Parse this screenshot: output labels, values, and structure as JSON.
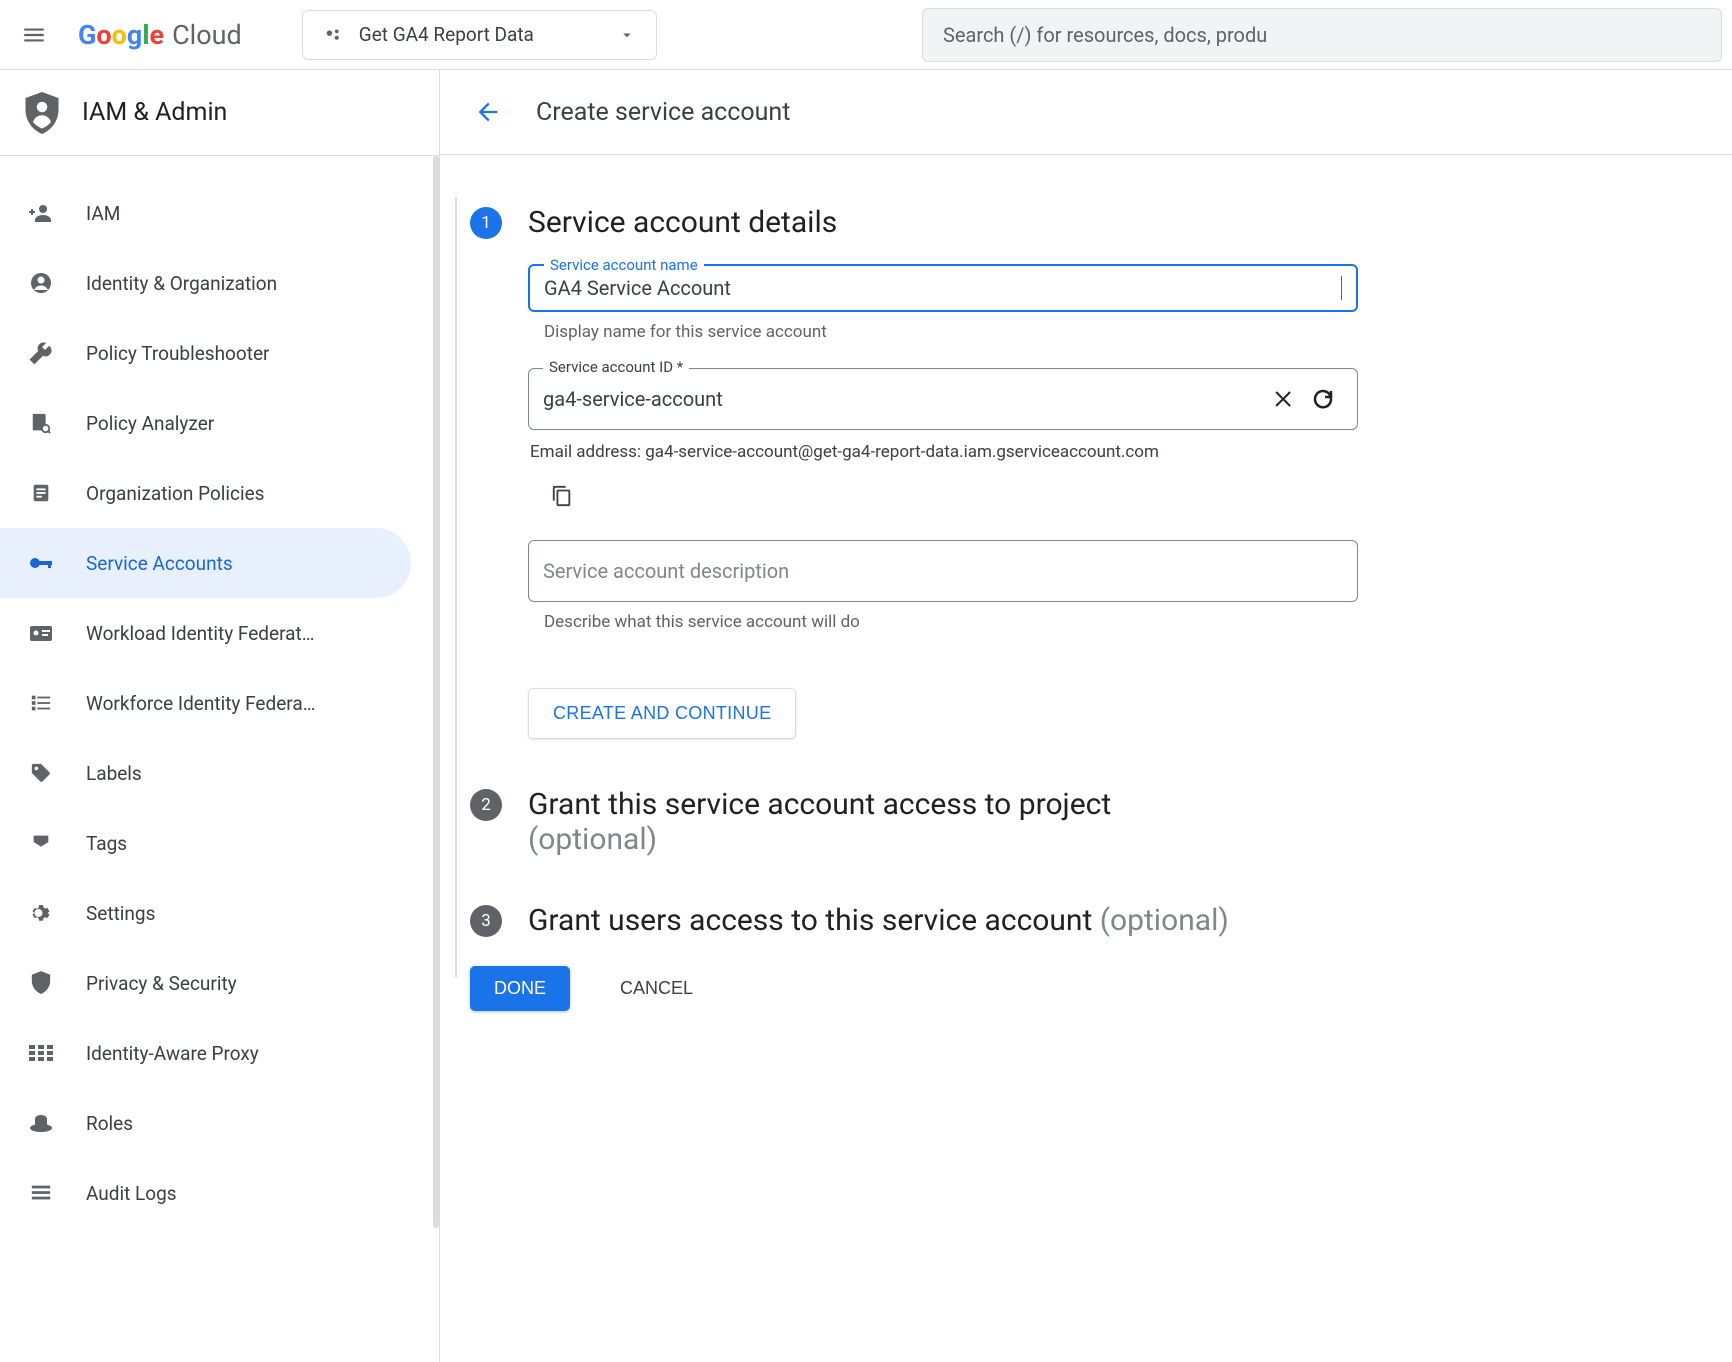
{
  "header": {
    "logo_cloud": "Cloud",
    "project_name": "Get GA4 Report Data",
    "search_placeholder": "Search (/) for resources, docs, produ"
  },
  "sidebar": {
    "title": "IAM & Admin",
    "items": [
      {
        "icon": "person-add",
        "label": "IAM"
      },
      {
        "icon": "account",
        "label": "Identity & Organization"
      },
      {
        "icon": "wrench",
        "label": "Policy Troubleshooter"
      },
      {
        "icon": "policy",
        "label": "Policy Analyzer"
      },
      {
        "icon": "doc",
        "label": "Organization Policies"
      },
      {
        "icon": "key",
        "label": "Service Accounts"
      },
      {
        "icon": "badge",
        "label": "Workload Identity Federat…"
      },
      {
        "icon": "list",
        "label": "Workforce Identity Federa…"
      },
      {
        "icon": "tag",
        "label": "Labels"
      },
      {
        "icon": "bookmark",
        "label": "Tags"
      },
      {
        "icon": "gear",
        "label": "Settings"
      },
      {
        "icon": "shield",
        "label": "Privacy & Security"
      },
      {
        "icon": "proxy",
        "label": "Identity-Aware Proxy"
      },
      {
        "icon": "hat",
        "label": "Roles"
      },
      {
        "icon": "lines",
        "label": "Audit Logs"
      }
    ],
    "active_index": 5
  },
  "page": {
    "title": "Create service account",
    "steps": {
      "s1": {
        "title": "Service account details",
        "name_label": "Service account name",
        "name_value": "GA4 Service Account",
        "name_helper": "Display name for this service account",
        "id_label": "Service account ID *",
        "id_value": "ga4-service-account",
        "email_prefix": "Email address: ",
        "email_value": "ga4-service-account@get-ga4-report-data.iam.gserviceaccount.com",
        "desc_placeholder": "Service account description",
        "desc_helper": "Describe what this service account will do",
        "create_continue": "CREATE AND CONTINUE"
      },
      "s2": {
        "title": "Grant this service account access to project",
        "optional": "(optional)"
      },
      "s3": {
        "title": "Grant users access to this service account ",
        "optional": "(optional)"
      }
    },
    "done": "DONE",
    "cancel": "CANCEL"
  }
}
